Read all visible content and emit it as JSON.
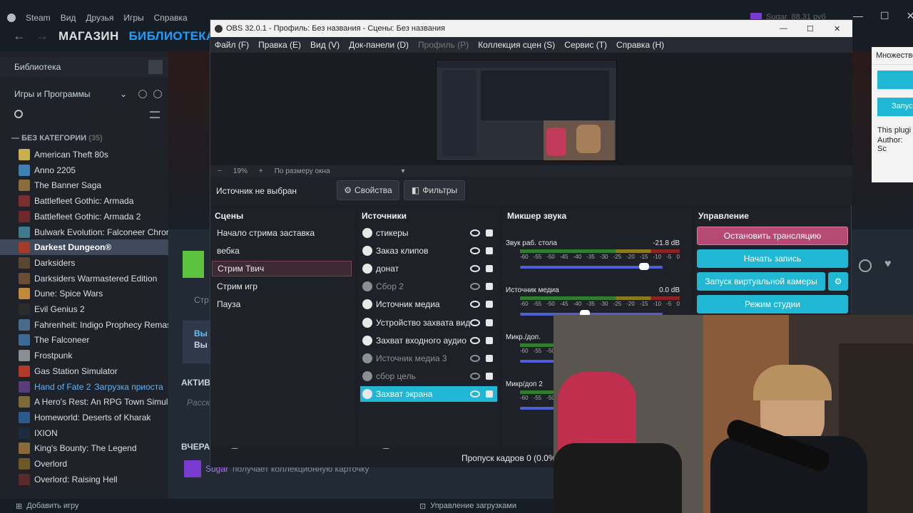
{
  "steam": {
    "menu": [
      "Steam",
      "Вид",
      "Друзья",
      "Игры",
      "Справка"
    ],
    "nav": {
      "store": "МАГАЗИН",
      "library": "БИБЛИОТЕКА",
      "community": "СО"
    },
    "sidebar": {
      "home": "Библиотека",
      "filter": "Игры и Программы",
      "category": "БЕЗ КАТЕГОРИИ",
      "category_count": "(35)",
      "games": [
        {
          "name": "American Theft 80s",
          "color": "#c8b14a"
        },
        {
          "name": "Anno 2205",
          "color": "#3f7fb3"
        },
        {
          "name": "The Banner Saga",
          "color": "#8a6b3c"
        },
        {
          "name": "Battlefleet Gothic: Armada",
          "color": "#7b2e2e"
        },
        {
          "name": "Battlefleet Gothic: Armada 2",
          "color": "#6e2a2a"
        },
        {
          "name": "Bulwark Evolution: Falconeer Chror",
          "color": "#3d7a8c"
        },
        {
          "name": "Darkest Dungeon®",
          "color": "#a33a2a"
        },
        {
          "name": "Darksiders",
          "color": "#5a4633"
        },
        {
          "name": "Darksiders Warmastered Edition",
          "color": "#6b4d33"
        },
        {
          "name": "Dune: Spice Wars",
          "color": "#c08a3a"
        },
        {
          "name": "Evil Genius 2",
          "color": "#2b2b2b"
        },
        {
          "name": "Fahrenheit: Indigo Prophecy Remas",
          "color": "#4a6a8a"
        },
        {
          "name": "The Falconeer",
          "color": "#3b6b94"
        },
        {
          "name": "Frostpunk",
          "color": "#8a8f95"
        },
        {
          "name": "Gas Station Simulator",
          "color": "#b33a2a"
        },
        {
          "name": "Hand of Fate 2",
          "color": "#5a3c7a",
          "status": "Загрузка приоста"
        },
        {
          "name": "A Hero's Rest: An RPG Town Simula",
          "color": "#7a6a3a"
        },
        {
          "name": "Homeworld: Deserts of Kharak",
          "color": "#2c5a8a"
        },
        {
          "name": "IXION",
          "color": "#1c2c3c"
        },
        {
          "name": "King's Bounty: The Legend",
          "color": "#8a6a3a"
        },
        {
          "name": "Overlord",
          "color": "#6a5a2a"
        },
        {
          "name": "Overlord: Raising Hell",
          "color": "#5a2a2a"
        }
      ],
      "selected": "Darkest Dungeon®"
    },
    "main": {
      "activity": "АКТИВ",
      "yesterday": "ВЧЕРА",
      "friend_name": "Sugar",
      "friend_action": "получает коллекционную карточку",
      "friend_text_1": "Вы",
      "friend_text_2": "Вы",
      "strip": "Стр",
      "activity_hint": "Расск"
    },
    "bottom": {
      "add_game": "Добавить игру",
      "downloads": "Управление загрузками"
    },
    "user": {
      "name": "Sugar",
      "balance": "88,31 руб"
    }
  },
  "obs": {
    "title": "OBS 32.0.1 - Профиль: Без названия - Сцены: Без названия",
    "menu": [
      "Файл (F)",
      "Правка (E)",
      "Вид (V)",
      "Док-панели (D)",
      "Профиль (P)",
      "Коллекция сцен (S)",
      "Сервис (T)",
      "Справка (H)"
    ],
    "zoom": "19%",
    "zoom_fit": "По размеру окна",
    "no_source": "Источник не выбран",
    "properties": "Свойства",
    "filters": "Фильтры",
    "scenes_title": "Сцены",
    "scenes": [
      "Начало стрима заставка",
      "вебка",
      "Стрим Твич",
      "Стрим игр",
      "Пауза"
    ],
    "selected_scene": "Стрим Твич",
    "sources_title": "Источники",
    "sources": [
      {
        "name": "стикеры",
        "visible": true
      },
      {
        "name": "Заказ клипов",
        "visible": true
      },
      {
        "name": "донат",
        "visible": true
      },
      {
        "name": "Сбор 2",
        "visible": false
      },
      {
        "name": "Источник медиа",
        "visible": true
      },
      {
        "name": "Устройство захвата вид",
        "visible": true
      },
      {
        "name": "Захват входного аудио",
        "visible": true
      },
      {
        "name": "Источник медиа 3",
        "visible": false
      },
      {
        "name": "сбор цель",
        "visible": false
      },
      {
        "name": "Захват экрана",
        "visible": true
      }
    ],
    "selected_source": "Захват экрана",
    "mixer_title": "Микшер звука",
    "mixer": [
      {
        "name": "Звук раб. стола",
        "db": "-21.8 dB",
        "volume": 0.9
      },
      {
        "name": "Источник медиа",
        "db": "0.0 dB",
        "volume": 0.45
      },
      {
        "name": "Микр./доп.",
        "db": "",
        "volume": 0.5
      },
      {
        "name": "Микр/доп 2",
        "db": "",
        "volume": 0.5
      }
    ],
    "meter_scale": [
      "-60",
      "-55",
      "-50",
      "-45",
      "-40",
      "-35",
      "-30",
      "-25",
      "-20",
      "-15",
      "-10",
      "-5",
      "0"
    ],
    "controls_title": "Управление",
    "controls": {
      "stop_stream": "Остановить трансляцию",
      "start_rec": "Начать запись",
      "virtual_cam": "Запуск виртуальной камеры",
      "studio": "Режим студии"
    },
    "status": "Пропуск кадров 0 (0.0%)",
    "colors": {
      "accent": "#1fb7d4",
      "stop": "#b64a73"
    }
  },
  "plugin": {
    "title": "Множестве",
    "text": "This plugi",
    "author": "Author: Sc",
    "button": "Запус"
  }
}
